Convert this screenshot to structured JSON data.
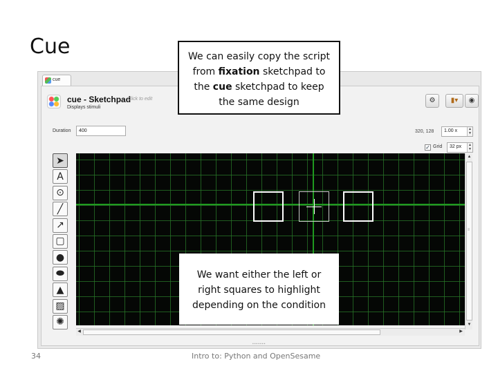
{
  "slide": {
    "title": "Cue",
    "page_number": "34",
    "footer": "Intro to: Python and OpenSesame"
  },
  "callouts": {
    "top": {
      "line1": "We can easily copy the script",
      "line2_pre": "from ",
      "line2_bold": "fixation",
      "line2_post": " sketchpad to",
      "line3_pre": "the ",
      "line3_bold": "cue",
      "line3_post": " sketchpad to keep",
      "line4": "the same design"
    },
    "bottom": {
      "line1": "We want either the left or",
      "line2": "right squares to highlight",
      "line3": "depending on the condition"
    }
  },
  "app": {
    "tab_label": "cue",
    "header": {
      "title": "cue - Sketchpad",
      "hint": "Click to edit",
      "subtitle": "Displays stimuli"
    },
    "duration": {
      "label": "Duration",
      "value": "400"
    },
    "cursor_readout": "320, 128",
    "zoom": "1.00 x",
    "grid": {
      "label": "Grid",
      "checked": true,
      "size": "32 px"
    },
    "tools": [
      {
        "name": "pointer-tool-icon",
        "glyph": "➤",
        "active": true
      },
      {
        "name": "text-tool-icon",
        "glyph": "A"
      },
      {
        "name": "fixdot-tool-icon",
        "glyph": "⊙"
      },
      {
        "name": "line-tool-icon",
        "glyph": "╱"
      },
      {
        "name": "arrow-tool-icon",
        "glyph": "↗"
      },
      {
        "name": "rect-tool-icon",
        "glyph": "▢"
      },
      {
        "name": "circle-tool-icon",
        "glyph": "●"
      },
      {
        "name": "ellipse-tool-icon",
        "glyph": "⬬"
      },
      {
        "name": "image-tool-icon",
        "glyph": "▲"
      },
      {
        "name": "gabor-tool-icon",
        "glyph": "▨"
      },
      {
        "name": "noise-tool-icon",
        "glyph": "✺"
      }
    ],
    "colors": {
      "canvas_bg": "#050705",
      "grid_line": "#287828",
      "axis_line": "#1f9a1f",
      "shape_stroke": "#ffffff"
    }
  }
}
